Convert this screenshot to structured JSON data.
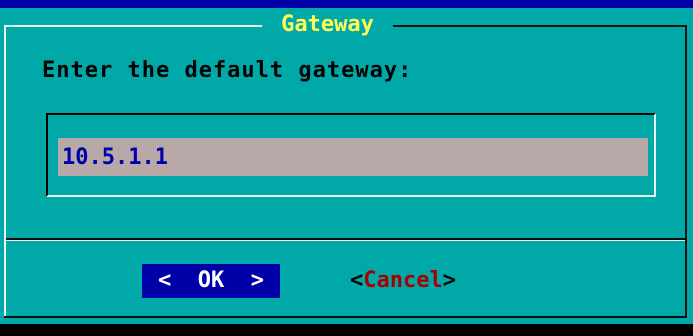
{
  "dialog": {
    "title": "Gateway",
    "prompt": "Enter the default gateway:",
    "field": {
      "value": "10.5.1.1"
    },
    "buttons": {
      "ok": "<  OK  >",
      "cancel_left": "<",
      "cancel_hotkey": "Cancel",
      "cancel_right": ">"
    }
  },
  "colors": {
    "background": "#0000a8",
    "dialog": "#00a8a8",
    "title": "#ffff55",
    "field_bg": "#b8a8a8",
    "field_text": "#0000a8",
    "hotkey": "#a80000"
  }
}
